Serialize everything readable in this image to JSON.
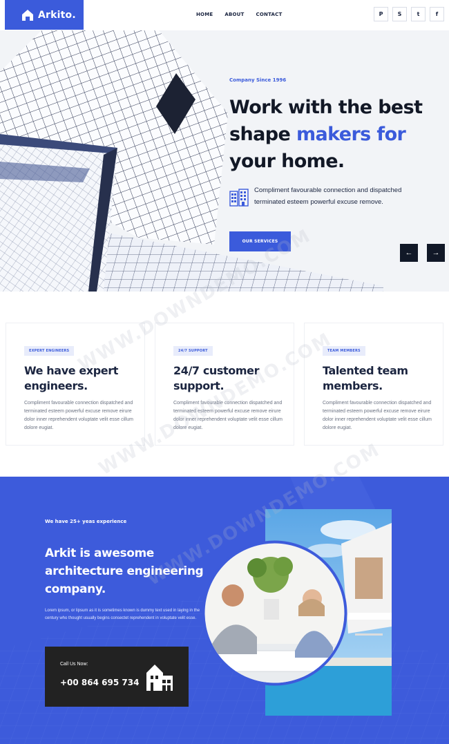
{
  "header": {
    "logo_text": "Arkito.",
    "nav": [
      {
        "label": "HOME"
      },
      {
        "label": "ABOUT"
      },
      {
        "label": "CONTACT"
      }
    ],
    "socials": [
      {
        "icon": "pinterest-icon",
        "glyph": "P"
      },
      {
        "icon": "skype-icon",
        "glyph": "S"
      },
      {
        "icon": "twitter-icon",
        "glyph": "t"
      },
      {
        "icon": "facebook-icon",
        "glyph": "f"
      }
    ]
  },
  "hero": {
    "eyebrow": "Company Since 1996",
    "title_line1": "Work with the best",
    "title_line2_a": "shape ",
    "title_line2_b": "makers for",
    "title_line3": "your home.",
    "description": "Compliment favourable connection and dispatched terminated esteem powerful excuse remove.",
    "button_label": "OUR SERVICES",
    "prev_arrow": "←",
    "next_arrow": "→"
  },
  "cards": [
    {
      "tag": "EXPERT ENGINEERS",
      "title": "We have expert engineers.",
      "text": "Compliment favourable connection dispatched and terminated esteem powerful excuse remove eirure dolor inner reprehendent voluptate velit esse cillum dolore eugiat."
    },
    {
      "tag": "24/7 SUPPORT",
      "title": "24/7 customer support.",
      "text": "Compliment favourable connection dispatched and terminated esteem powerful excuse remove eirure dolor inner reprehendent voluptate velit esse cillum dolore eugiat."
    },
    {
      "tag": "TEAM MEMBERS",
      "title": "Talented team members.",
      "text": "Compliment favourable connection dispatched and terminated esteem powerful excuse remove eirure dolor inner reprehendent voluptate velit esse cillum dolore eugiat."
    }
  ],
  "about": {
    "eyebrow": "We have 25+ yeas experience",
    "title": "Arkit is awesome architecture engineering company.",
    "text": "Lorem ipsum, or lipsum as it is sometimes known is dummy text used in laying in the century who thought usually begins consectet reprehendent in voluptate velit esse.",
    "call_label": "Call Us Now:",
    "call_number": "+00 864 695 734"
  },
  "watermark": "WWW.DOWNDEMO.COM",
  "colors": {
    "accent": "#3b5bdb",
    "dark": "#121826",
    "call_box": "#222222"
  }
}
